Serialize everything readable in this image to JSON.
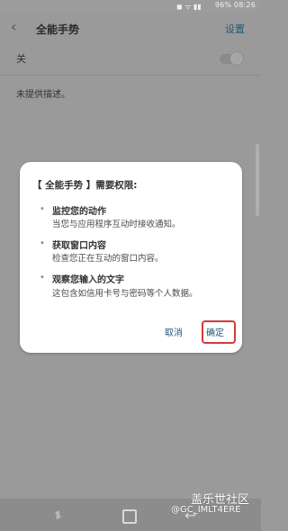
{
  "status_bar": {
    "text": "96% 08:26"
  },
  "header": {
    "back_icon": "chevron-left-icon",
    "title": "全能手势",
    "settings_label": "设置"
  },
  "switch_row": {
    "label": "关",
    "state": "off"
  },
  "description": "未提供描述。",
  "dialog": {
    "title": "【 全能手势 】需要权限:",
    "items": [
      {
        "title": "监控您的动作",
        "desc": "当您与应用程序互动时接收通知。"
      },
      {
        "title": "获取窗口内容",
        "desc": "检查您正在互动的窗口内容。"
      },
      {
        "title": "观察您输入的文字",
        "desc": "这包含如信用卡号与密码等个人数据。"
      }
    ],
    "cancel_label": "取消",
    "ok_label": "确定"
  },
  "nav": {
    "recent_icon": "recent-apps-icon",
    "home_icon": "home-icon",
    "back_icon": "back-icon"
  },
  "watermark": {
    "line1": "盖乐世社区",
    "line2": "@GC_IMLT4ERE"
  },
  "colors": {
    "accent": "#1f5b78",
    "highlight": "#d33a3a"
  }
}
